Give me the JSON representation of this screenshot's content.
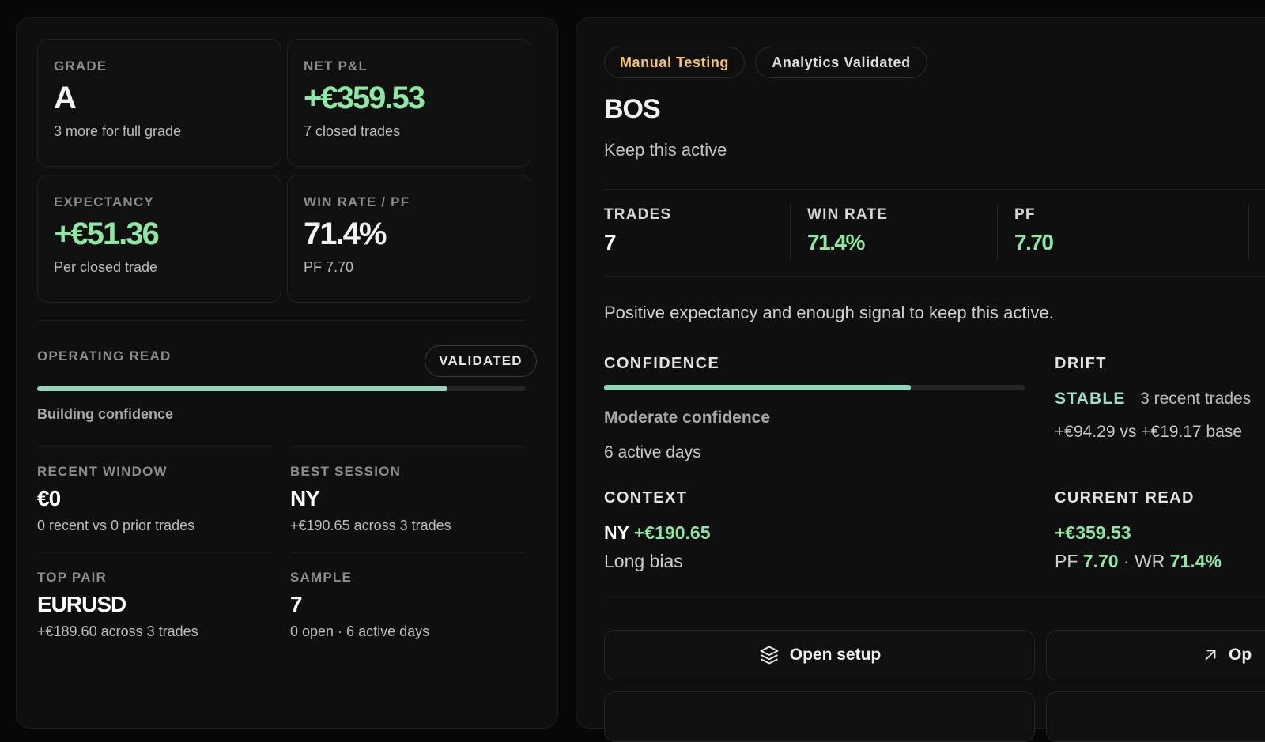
{
  "left": {
    "cards": {
      "grade": {
        "label": "GRADE",
        "value": "A",
        "sub": "3 more for full grade"
      },
      "net_pl": {
        "label": "NET P&L",
        "value": "+€359.53",
        "sub": "7 closed trades"
      },
      "expectancy": {
        "label": "EXPECTANCY",
        "value": "+€51.36",
        "sub": "Per closed trade"
      },
      "win_rate_pf": {
        "label": "WIN RATE / PF",
        "value": "71.4%",
        "sub": "PF 7.70"
      }
    },
    "operating_read": {
      "label": "OPERATING READ",
      "badge": "VALIDATED",
      "progress": 0.84,
      "status": "Building confidence"
    },
    "recent_window": {
      "label": "RECENT WINDOW",
      "value": "€0",
      "note": "0 recent vs 0 prior trades"
    },
    "best_session": {
      "label": "BEST SESSION",
      "value": "NY",
      "note": "+€190.65 across 3 trades"
    },
    "top_pair": {
      "label": "TOP PAIR",
      "value": "EURUSD",
      "note": "+€189.60 across 3 trades"
    },
    "sample": {
      "label": "SAMPLE",
      "value": "7",
      "note": "0 open · 6 active days"
    }
  },
  "right": {
    "tags": {
      "manual": "Manual Testing",
      "analytics": "Analytics Validated"
    },
    "title": "BOS",
    "subtitle": "Keep this active",
    "metrics": {
      "trades": {
        "label": "TRADES",
        "value": "7"
      },
      "win_rate": {
        "label": "WIN RATE",
        "value": "71.4%"
      },
      "pf": {
        "label": "PF",
        "value": "7.70"
      }
    },
    "summary": "Positive expectancy and enough signal to keep this active.",
    "confidence": {
      "label": "CONFIDENCE",
      "progress": 0.73,
      "level": "Moderate confidence",
      "days": "6 active days"
    },
    "drift": {
      "label": "DRIFT",
      "status": "STABLE",
      "recent": "3 recent trades",
      "compare": "+€94.29 vs +€19.17 base"
    },
    "context": {
      "label": "CONTEXT",
      "session": "NY",
      "amount": "+€190.65",
      "bias": "Long bias"
    },
    "current_read": {
      "label": "CURRENT READ",
      "value": "+€359.53",
      "pf_label": "PF",
      "pf": "7.70",
      "sep": "·",
      "wr_label": "WR",
      "wr": "71.4%"
    },
    "buttons": {
      "open_setup": "Open setup",
      "open_other": "Op"
    }
  },
  "colors": {
    "green": "#8ee8a4",
    "amber": "#f2c36b",
    "teal_bar": "#8fd6bb",
    "background": "#070707",
    "panel": "#0f0f0f"
  },
  "icons": {
    "open_setup": "layers-icon",
    "open_other": "arrow-up-right-icon"
  }
}
